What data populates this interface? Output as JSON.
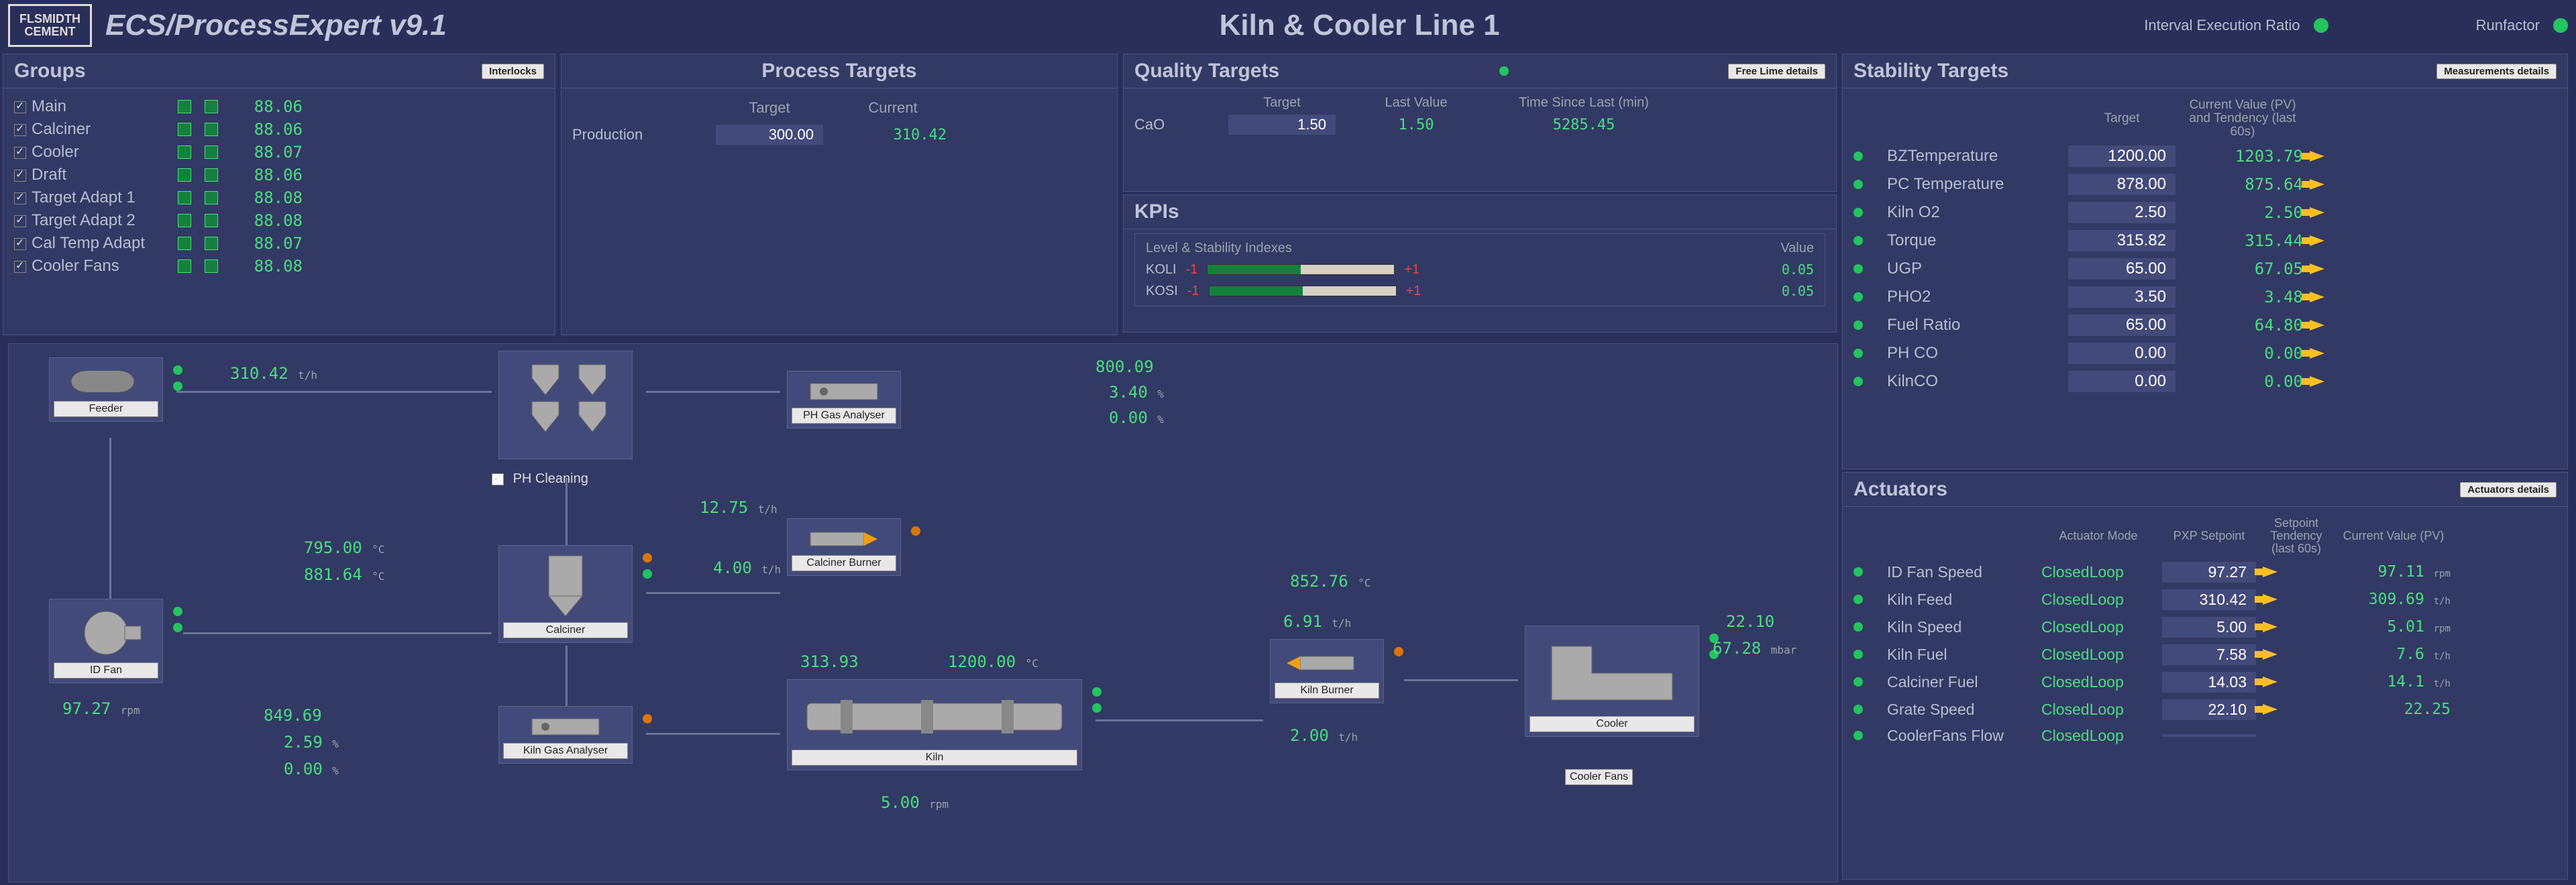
{
  "app": {
    "title": "ECS/ProcessExpert v9.1",
    "screen": "Kiln & Cooler  Line 1",
    "logo_top": "FLSMIDTH",
    "logo_bot": "CEMENT",
    "interval_label": "Interval Execution Ratio",
    "runfactor_label": "Runfactor"
  },
  "groups": {
    "title": "Groups",
    "btn": "Interlocks",
    "items": [
      {
        "name": "Main",
        "val": "88.06"
      },
      {
        "name": "Calciner",
        "val": "88.06"
      },
      {
        "name": "Cooler",
        "val": "88.07"
      },
      {
        "name": "Draft",
        "val": "88.06"
      },
      {
        "name": "Target Adapt 1",
        "val": "88.08"
      },
      {
        "name": "Target Adapt 2",
        "val": "88.08"
      },
      {
        "name": "Cal Temp Adapt",
        "val": "88.07"
      },
      {
        "name": "Cooler Fans",
        "val": "88.08"
      }
    ]
  },
  "process": {
    "title": "Process Targets",
    "h_target": "Target",
    "h_current": "Current",
    "row_label": "Production",
    "target": "300.00",
    "current": "310.42"
  },
  "quality": {
    "title": "Quality Targets",
    "btn": "Free Lime details",
    "h_target": "Target",
    "h_last": "Last Value",
    "h_time": "Time Since Last (min)",
    "row_label": "CaO",
    "target": "1.50",
    "last": "1.50",
    "time": "5285.45"
  },
  "kpi": {
    "title": "KPIs",
    "sub": "Level & Stability Indexes",
    "h_value": "Value",
    "rows": [
      {
        "name": "KOLI",
        "lo": "-1",
        "hi": "+1",
        "val": "0.05"
      },
      {
        "name": "KOSI",
        "lo": "-1",
        "hi": "+1",
        "val": "0.05"
      }
    ]
  },
  "stability": {
    "title": "Stability Targets",
    "btn": "Measurements details",
    "h_target": "Target",
    "h_pv": "Current Value (PV) and Tendency (last 60s)",
    "rows": [
      {
        "name": "BZTemperature",
        "target": "1200.00",
        "pv": "1203.79"
      },
      {
        "name": "PC Temperature",
        "target": "878.00",
        "pv": "875.64"
      },
      {
        "name": "Kiln O2",
        "target": "2.50",
        "pv": "2.50"
      },
      {
        "name": "Torque",
        "target": "315.82",
        "pv": "315.44"
      },
      {
        "name": "UGP",
        "target": "65.00",
        "pv": "67.05"
      },
      {
        "name": "PHO2",
        "target": "3.50",
        "pv": "3.48"
      },
      {
        "name": "Fuel Ratio",
        "target": "65.00",
        "pv": "64.80"
      },
      {
        "name": "PH CO",
        "target": "0.00",
        "pv": "0.00"
      },
      {
        "name": "KilnCO",
        "target": "0.00",
        "pv": "0.00"
      }
    ]
  },
  "actuators": {
    "title": "Actuators",
    "btn": "Actuators details",
    "h_mode": "Actuator Mode",
    "h_sp": "PXP Setpoint",
    "h_tend": "Setpoint Tendency (last 60s)",
    "h_pv": "Current Value (PV)",
    "rows": [
      {
        "name": "ID Fan Speed",
        "mode": "ClosedLoop",
        "sp": "97.27",
        "pv": "97.11",
        "unit": "rpm"
      },
      {
        "name": "Kiln Feed",
        "mode": "ClosedLoop",
        "sp": "310.42",
        "pv": "309.69",
        "unit": "t/h"
      },
      {
        "name": "Kiln Speed",
        "mode": "ClosedLoop",
        "sp": "5.00",
        "pv": "5.01",
        "unit": "rpm"
      },
      {
        "name": "Kiln Fuel",
        "mode": "ClosedLoop",
        "sp": "7.58",
        "pv": "7.6",
        "unit": "t/h"
      },
      {
        "name": "Calciner Fuel",
        "mode": "ClosedLoop",
        "sp": "14.03",
        "pv": "14.1",
        "unit": "t/h"
      },
      {
        "name": "Grate Speed",
        "mode": "ClosedLoop",
        "sp": "22.10",
        "pv": "22.25",
        "unit": ""
      },
      {
        "name": "CoolerFans Flow",
        "mode": "ClosedLoop",
        "sp": "",
        "pv": "",
        "unit": ""
      }
    ]
  },
  "equip": {
    "feeder": "Feeder",
    "ph_clean": "PH Cleaning",
    "ph_gas": "PH Gas Analyser",
    "calciner": "Calciner",
    "calciner_burner": "Calciner Burner",
    "id_fan": "ID Fan",
    "kiln_gas": "Kiln Gas Analyser",
    "kiln": "Kiln",
    "kiln_burner": "Kiln Burner",
    "cooler": "Cooler",
    "cooler_fans": "Cooler Fans"
  },
  "flow": {
    "feed": "310.42",
    "feed_u": "t/h",
    "ph1": "800.09",
    "ph2": "3.40",
    "ph2_u": "%",
    "ph3": "0.00",
    "ph3_u": "%",
    "gas1": "795.00",
    "gas1_u": "°C",
    "gas2": "881.64",
    "gas2_u": "°C",
    "cb1": "12.75",
    "cb1_u": "t/h",
    "cb2": "4.00",
    "cb2_u": "t/h",
    "idfan": "97.27",
    "idfan_u": "rpm",
    "kga1": "849.69",
    "kga2": "2.59",
    "kga2_u": "%",
    "kga3": "0.00",
    "kga3_u": "%",
    "kiln1": "313.93",
    "kiln2": "1200.00",
    "kiln2_u": "°C",
    "kiln3": "5.00",
    "kiln3_u": "rpm",
    "cool": "852.76",
    "cool_u": "°C",
    "kb1": "6.91",
    "kb1_u": "t/h",
    "kb2": "2.00",
    "kb2_u": "t/h",
    "cf1": "22.10",
    "cf2": "67.28",
    "cf2_u": "mbar"
  }
}
